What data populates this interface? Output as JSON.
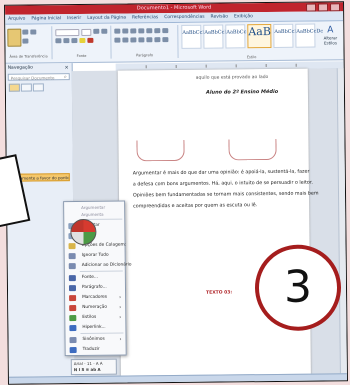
{
  "window": {
    "title": "Documento1 - Microsoft Word"
  },
  "ribbon": {
    "tabs": [
      "Arquivo",
      "Página Inicial",
      "Inserir",
      "Layout da Página",
      "Referências",
      "Correspondências",
      "Revisão",
      "Exibição"
    ],
    "groups": [
      "Área de Transferência",
      "Fonte",
      "Parágrafo",
      "Estilo"
    ],
    "styles": [
      {
        "sample": "AaBbCcDc",
        "name": "Normal"
      },
      {
        "sample": "AaBbCcDc",
        "name": "Sem Esp..."
      },
      {
        "sample": "AaBbCc",
        "name": "Título 1"
      },
      {
        "sample": "AaB",
        "name": "Título"
      },
      {
        "sample": "AaBbCcDc",
        "name": "Subtítulo"
      },
      {
        "sample": "AaBbCcDc",
        "name": "Ênfase Sutil"
      }
    ],
    "change_styles": "Alterar Estilos",
    "editing": "Editar"
  },
  "nav": {
    "title": "Navegação",
    "search_placeholder": "Pesquisar Documento",
    "heading_item": "Argumente a favor do ponto de vista"
  },
  "document": {
    "top_line": "aquilo que está provado ao lado",
    "byline": "Aluno do 2º Ensino Médio",
    "paragraph": [
      "Argumentar é mais do que dar uma opinião: é apoiá-la, sustentá-la, fazer",
      "a defesa com bons argumentos. Há, aqui, o intuito de se persuadir o leitor.",
      "Opiniões bem fundamentadas se tornam mais consistentes, sendo mais bem",
      "compreendidas e aceitas por quem as escuta ou lê."
    ],
    "emphasis": "Argumentar",
    "texto_label": "TEXTO 03:"
  },
  "context_menu": {
    "suggestions": [
      "Argumentar",
      "Argumenta"
    ],
    "items": [
      {
        "label": "Recortar",
        "icon": "scissors-icon",
        "color": "#8aa0bf",
        "submenu": false
      },
      {
        "label": "Copiar",
        "icon": "copy-icon",
        "color": "#8aa0bf",
        "submenu": false
      },
      {
        "label": "Opções de Colagem:",
        "icon": "paste-icon",
        "color": "#d9b54a",
        "submenu": false
      },
      {
        "label": "Ignorar Tudo",
        "icon": "ignore-icon",
        "color": "#7a8bb0",
        "submenu": false
      },
      {
        "label": "Adicionar ao Dicionário",
        "icon": "dictionary-icon",
        "color": "#7a8bb0",
        "submenu": false
      },
      {
        "label": "Fonte...",
        "icon": "font-icon",
        "color": "#4a67a8",
        "submenu": false
      },
      {
        "label": "Parágrafo...",
        "icon": "paragraph-icon",
        "color": "#4a67a8",
        "submenu": false
      },
      {
        "label": "Marcadores",
        "icon": "bullets-icon",
        "color": "#c9463a",
        "submenu": true
      },
      {
        "label": "Numeração",
        "icon": "numbering-icon",
        "color": "#c9463a",
        "submenu": true
      },
      {
        "label": "Estilos",
        "icon": "styles-icon",
        "color": "#4c9a45",
        "submenu": true
      },
      {
        "label": "Hiperlink...",
        "icon": "hyperlink-icon",
        "color": "#3d6cc0",
        "submenu": false
      },
      {
        "label": "Sinônimos",
        "icon": "synonyms-icon",
        "color": "#7a8bb0",
        "submenu": true
      },
      {
        "label": "Traduzir",
        "icon": "translate-icon",
        "color": "#3d6cc0",
        "submenu": false
      }
    ]
  },
  "mini_toolbar": {
    "row1": "Arial  - 11  - A  A",
    "row2": "N  I  S  ≡  ab  A"
  },
  "badge": {
    "number": "3"
  }
}
